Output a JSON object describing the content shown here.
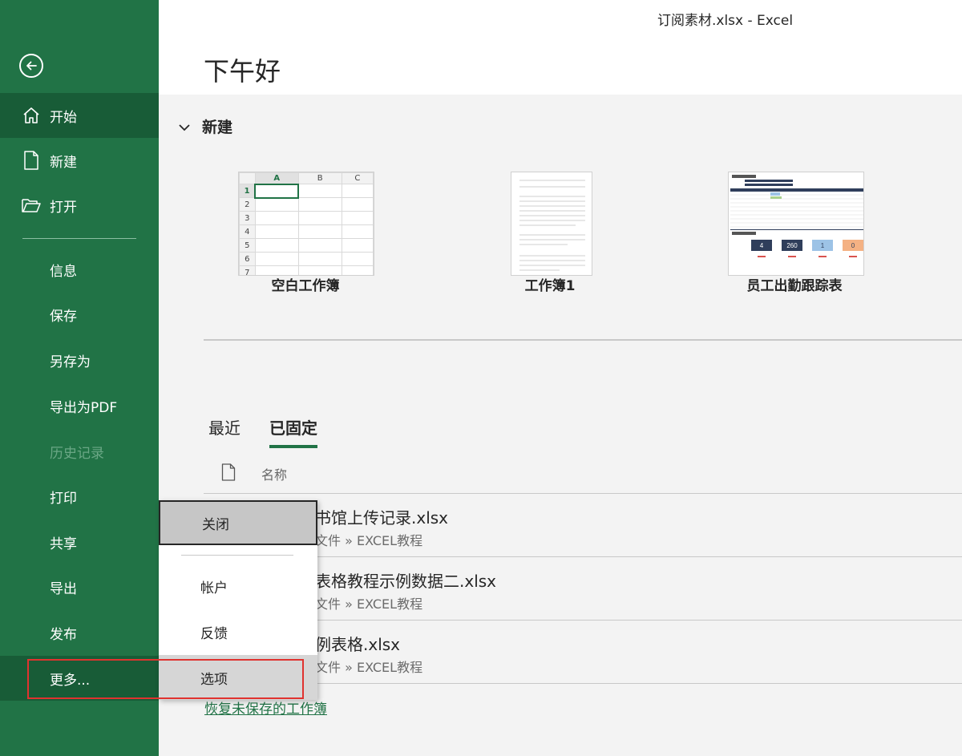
{
  "window": {
    "title": "订阅素材.xlsx  -  Excel"
  },
  "header": {
    "greeting": "下午好"
  },
  "sidebar": {
    "back_icon": "back-arrow-icon",
    "items": [
      {
        "label": "开始",
        "icon": "home-icon",
        "active": true
      },
      {
        "label": "新建",
        "icon": "new-file-icon"
      },
      {
        "label": "打开",
        "icon": "open-folder-icon"
      },
      {
        "label": "信息"
      },
      {
        "label": "保存"
      },
      {
        "label": "另存为"
      },
      {
        "label": "导出为PDF"
      },
      {
        "label": "历史记录",
        "disabled": true
      },
      {
        "label": "打印"
      },
      {
        "label": "共享"
      },
      {
        "label": "导出"
      },
      {
        "label": "发布"
      },
      {
        "label": "更多..."
      }
    ]
  },
  "new_section": {
    "title": "新建",
    "templates": [
      {
        "label": "空白工作簿",
        "columns": [
          "A",
          "B",
          "C"
        ],
        "rows": [
          "1",
          "2",
          "3",
          "4",
          "5",
          "6",
          "7"
        ]
      },
      {
        "label": "工作簿1"
      },
      {
        "label": "员工出勤跟踪表",
        "preview_values": [
          "4",
          "260",
          "1",
          "0"
        ]
      }
    ]
  },
  "files_section": {
    "tabs": [
      {
        "label": "最近",
        "active": false
      },
      {
        "label": "已固定",
        "active": true
      }
    ],
    "column_header": "名称",
    "files": [
      {
        "name": "书馆上传记录.xlsx",
        "path": "文件 » EXCEL教程"
      },
      {
        "name": "表格教程示例数据二.xlsx",
        "path": "文件 » EXCEL教程"
      },
      {
        "name": "例表格.xlsx",
        "path": "文件 » EXCEL教程"
      }
    ],
    "recover_link": "恢复未保存的工作簿"
  },
  "popup_menu": {
    "items": [
      {
        "label": "关闭",
        "state": "focused"
      },
      {
        "label": "帐户"
      },
      {
        "label": "反馈"
      },
      {
        "label": "选项",
        "state": "hover"
      }
    ]
  },
  "colors": {
    "sidebar_bg": "#217346",
    "sidebar_active": "#185c37",
    "accent": "#217346",
    "highlight_box": "#e0332f"
  }
}
